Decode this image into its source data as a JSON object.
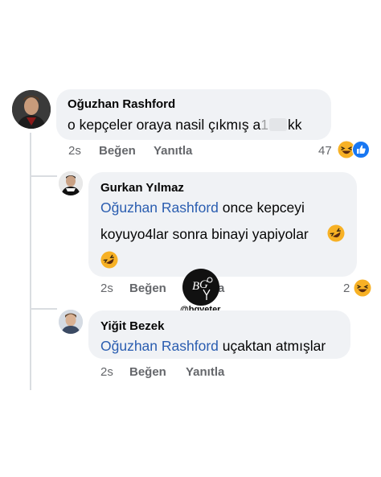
{
  "comments": [
    {
      "author": "Oğuzhan Rashford",
      "text_prefix": "o kepçeler oraya nasil çıkmış a",
      "text_mid": "1",
      "text_suffix": "kk",
      "time": "2s",
      "like": "Beğen",
      "reply": "Yanıtla",
      "reaction_count": "47",
      "reactions": [
        "haha-emoji",
        "like-emoji"
      ]
    },
    {
      "author": "Gurkan Yılmaz",
      "mention": "Oğuzhan Rashford",
      "text_line1": "once kepceyi",
      "text_line2": "koyuyo4lar sonra binayi yapiyolar",
      "time": "2s",
      "like": "Beğen",
      "reply": "a",
      "reaction_count": "2",
      "reactions": [
        "haha-emoji"
      ]
    },
    {
      "author": "Yiğit Bezek",
      "mention": "Oğuzhan Rashford",
      "text": "uçaktan atmışlar",
      "time": "2s",
      "like": "Beğen",
      "reply": "Yanıtla"
    }
  ],
  "watermark": {
    "handle": "@bgyeter",
    "logo_text": "BGY"
  },
  "colors": {
    "bubble": "#f0f2f5",
    "mention": "#2a5db0",
    "meta": "#65676b",
    "like_blue": "#1877f2",
    "emoji_yellow": "#f7b125"
  }
}
